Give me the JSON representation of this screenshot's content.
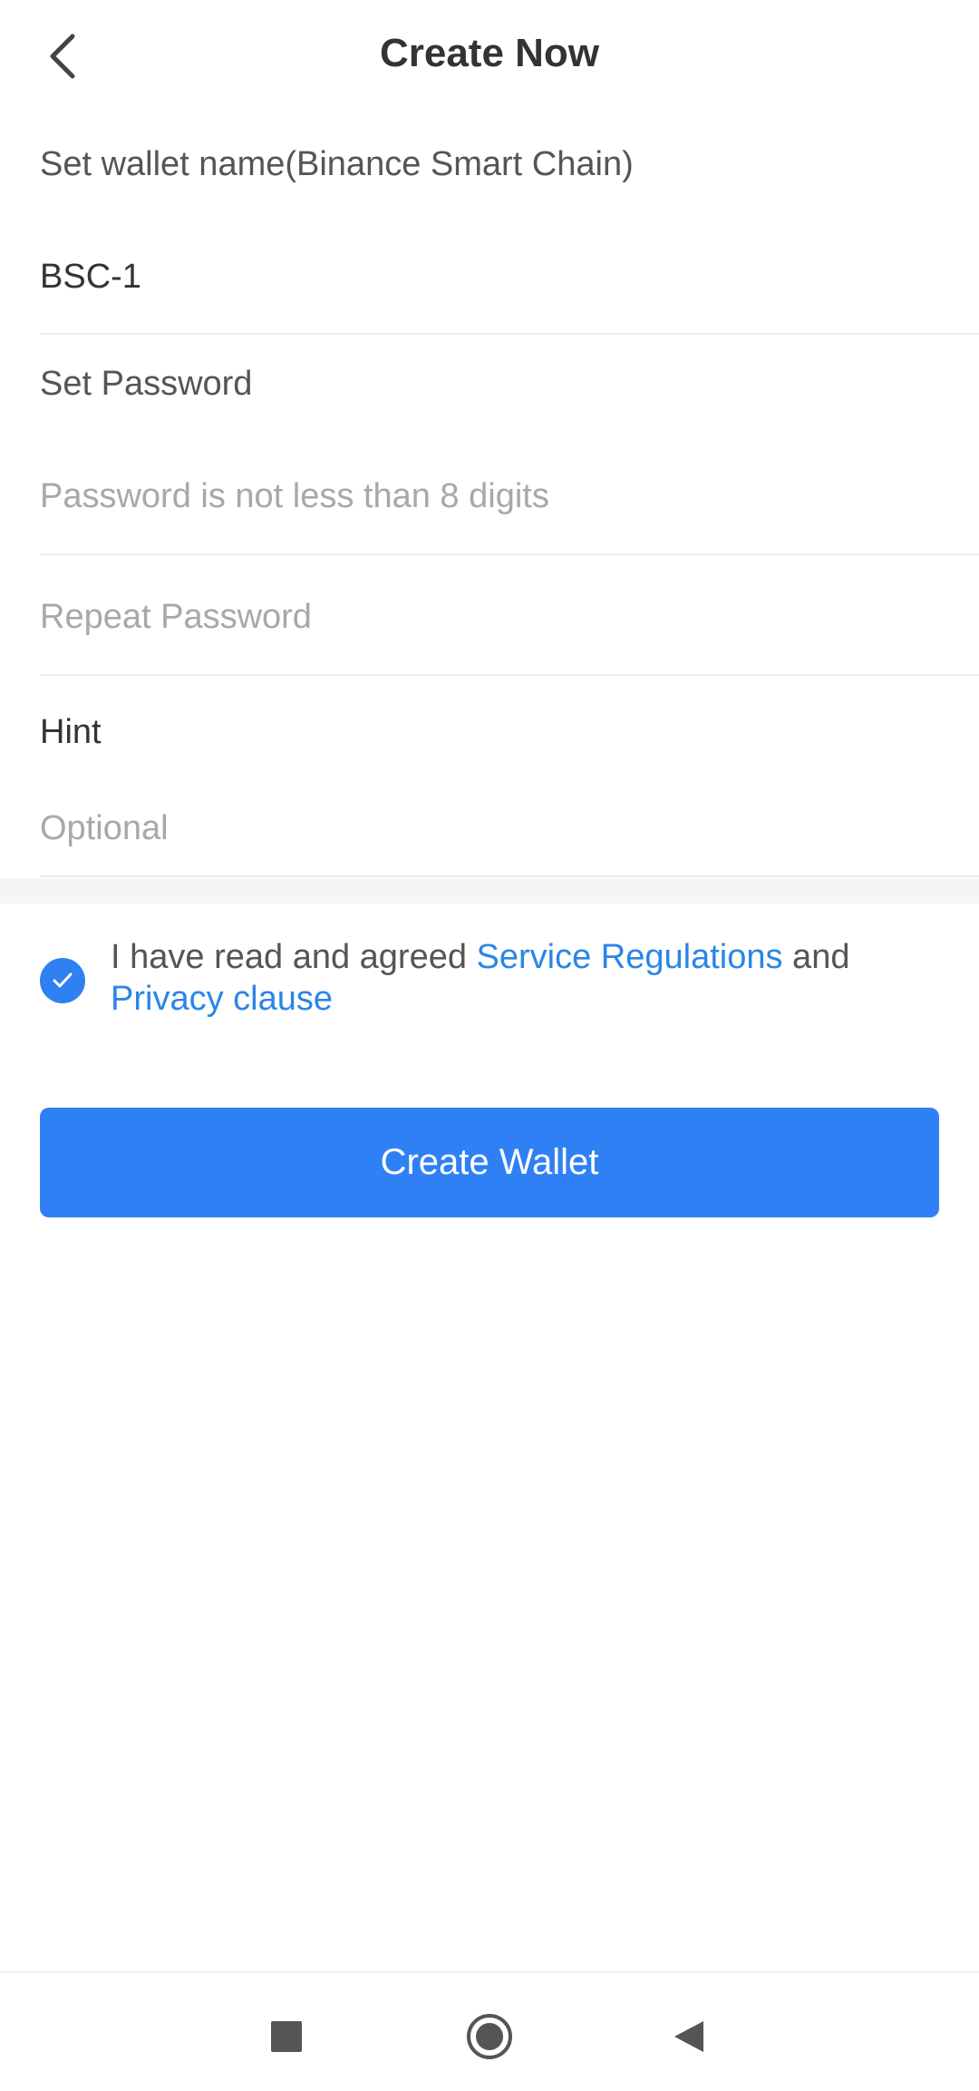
{
  "header": {
    "title": "Create Now",
    "back_icon": "chevron-left-icon"
  },
  "form": {
    "wallet_name_label": "Set wallet name(Binance Smart Chain)",
    "wallet_name_value": "BSC-1",
    "password_label": "Set Password",
    "password_placeholder": "Password is not less than 8 digits",
    "repeat_password_placeholder": "Repeat Password",
    "hint_label": "Hint",
    "hint_placeholder": "Optional"
  },
  "agreement": {
    "checked": true,
    "text_prefix": "I have read and agreed ",
    "service_link": "Service Regulations",
    "text_middle": " and",
    "privacy_link": "Privacy clause"
  },
  "actions": {
    "create_button": "Create Wallet"
  },
  "nav": {
    "recent_icon": "square-icon",
    "home_icon": "circle-home-icon",
    "back_icon": "triangle-back-icon"
  },
  "colors": {
    "accent": "#2f80f5",
    "link": "#2a86e6",
    "text_primary": "#333333",
    "text_secondary": "#555555",
    "placeholder": "#a8a8a8"
  }
}
